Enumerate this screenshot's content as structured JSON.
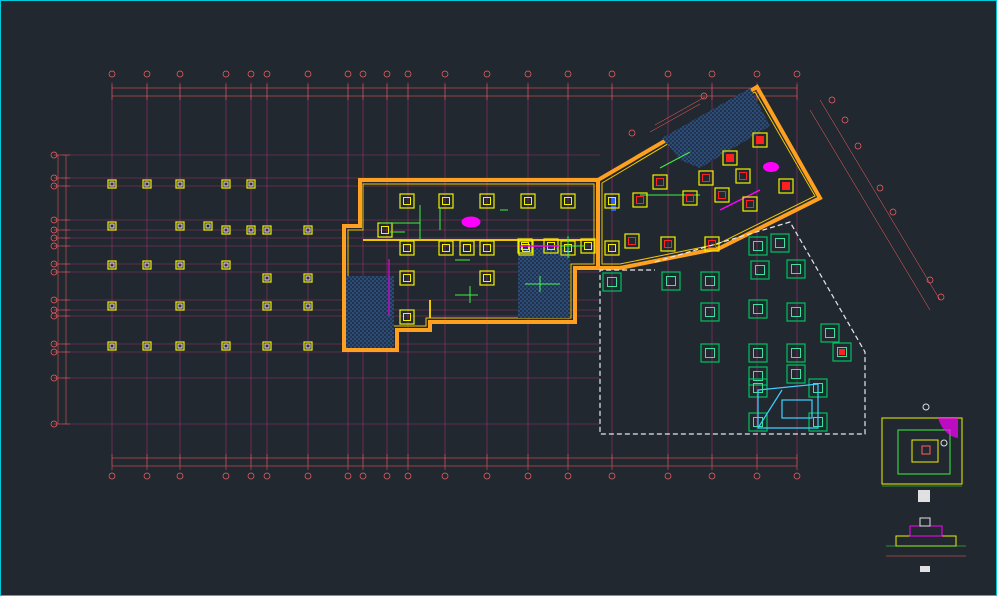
{
  "drawing": {
    "title": "",
    "colors": {
      "background": "#212830",
      "frame": "#00c8d8",
      "grid": "#a0306a",
      "dimension": "#ff6060",
      "wall": "#f0c800",
      "wall_outline": "#ffa020",
      "footing": "#f0f000",
      "footing_new": "#00c060",
      "footing_new_inner": "#40e0a0",
      "hatch": "#3a78b8",
      "pipe_green": "#40f040",
      "accent_magenta": "#ff00ff",
      "accent_red": "#ff2020",
      "boundary_dash": "#e8e8e8",
      "beam_cyan": "#40d0ff"
    },
    "icons": [
      "axis-bubble-icon",
      "footing-square-icon",
      "hatch-pattern-icon",
      "section-detail-icon"
    ]
  },
  "grid": {
    "columns": [
      112,
      147,
      180,
      226,
      251,
      267,
      308,
      348,
      363,
      387,
      408,
      445,
      487,
      528,
      568,
      612,
      668,
      712,
      757,
      797
    ],
    "rows": [
      155,
      178,
      186,
      220,
      230,
      238,
      246,
      264,
      272,
      300,
      310,
      316,
      344,
      352,
      378,
      424
    ]
  }
}
